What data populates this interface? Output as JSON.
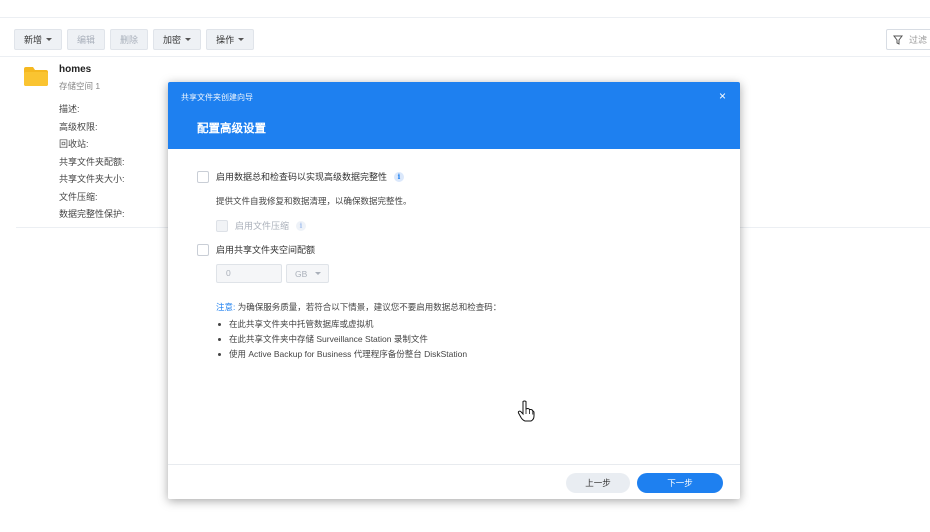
{
  "toolbar": {
    "create": "新增",
    "edit": "编辑",
    "delete": "删除",
    "encrypt": "加密",
    "action": "操作"
  },
  "filter": {
    "placeholder": "过滤"
  },
  "folder": {
    "name": "homes",
    "volume": "存储空间 1",
    "properties": [
      "描述:",
      "高级权限:",
      "回收站:",
      "共享文件夹配额:",
      "共享文件夹大小:",
      "文件压缩:",
      "数据完整性保护:"
    ]
  },
  "dialog": {
    "wizard_title": "共享文件夹创建向导",
    "close": "×",
    "step_title": "配置高级设置",
    "checksum_label": "启用数据总和检查码以实现高级数据完整性",
    "checksum_desc": "提供文件自我修复和数据清理，以确保数据完整性。",
    "compression_label": "启用文件压缩",
    "quota_label": "启用共享文件夹空间配额",
    "quota_value": "0",
    "quota_unit": "GB",
    "note_label": "注意:",
    "note_text": "为确保服务质量，若符合以下情景，建议您不要启用数据总和检查码：",
    "bullets": [
      "在此共享文件夹中托管数据库或虚拟机",
      "在此共享文件夹中存储 Surveillance Station 录制文件",
      "使用 Active Backup for Business 代理程序备份整台 DiskStation"
    ],
    "prev_button": "上一步",
    "next_button": "下一步"
  },
  "colors": {
    "accent": "#1e80f0",
    "folder": "#f5b820"
  }
}
